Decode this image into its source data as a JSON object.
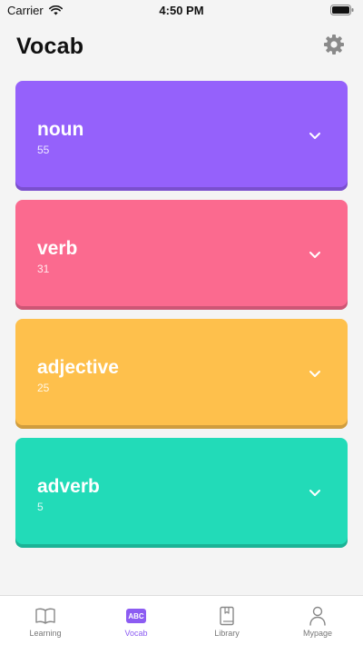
{
  "status_bar": {
    "carrier": "Carrier",
    "time": "4:50 PM"
  },
  "header": {
    "title": "Vocab",
    "settings_icon": "gear-icon"
  },
  "categories": [
    {
      "title": "noun",
      "count": "55",
      "color": "#9561fb",
      "icon": "chevron-down-icon"
    },
    {
      "title": "verb",
      "count": "31",
      "color": "#fb6a8f",
      "icon": "chevron-down-icon"
    },
    {
      "title": "adjective",
      "count": "25",
      "color": "#fec04c",
      "icon": "chevron-down-icon"
    },
    {
      "title": "adverb",
      "count": "5",
      "color": "#22dbb8",
      "icon": "chevron-down-icon"
    }
  ],
  "tab_bar": {
    "tabs": [
      {
        "label": "Learning",
        "icon": "open-book-icon",
        "active": false
      },
      {
        "label": "Vocab",
        "icon": "abc-icon",
        "badge": "ABC",
        "active": true
      },
      {
        "label": "Library",
        "icon": "book-icon",
        "active": false
      },
      {
        "label": "Mypage",
        "icon": "person-icon",
        "active": false
      }
    ],
    "active_color": "#8c5cf2"
  }
}
